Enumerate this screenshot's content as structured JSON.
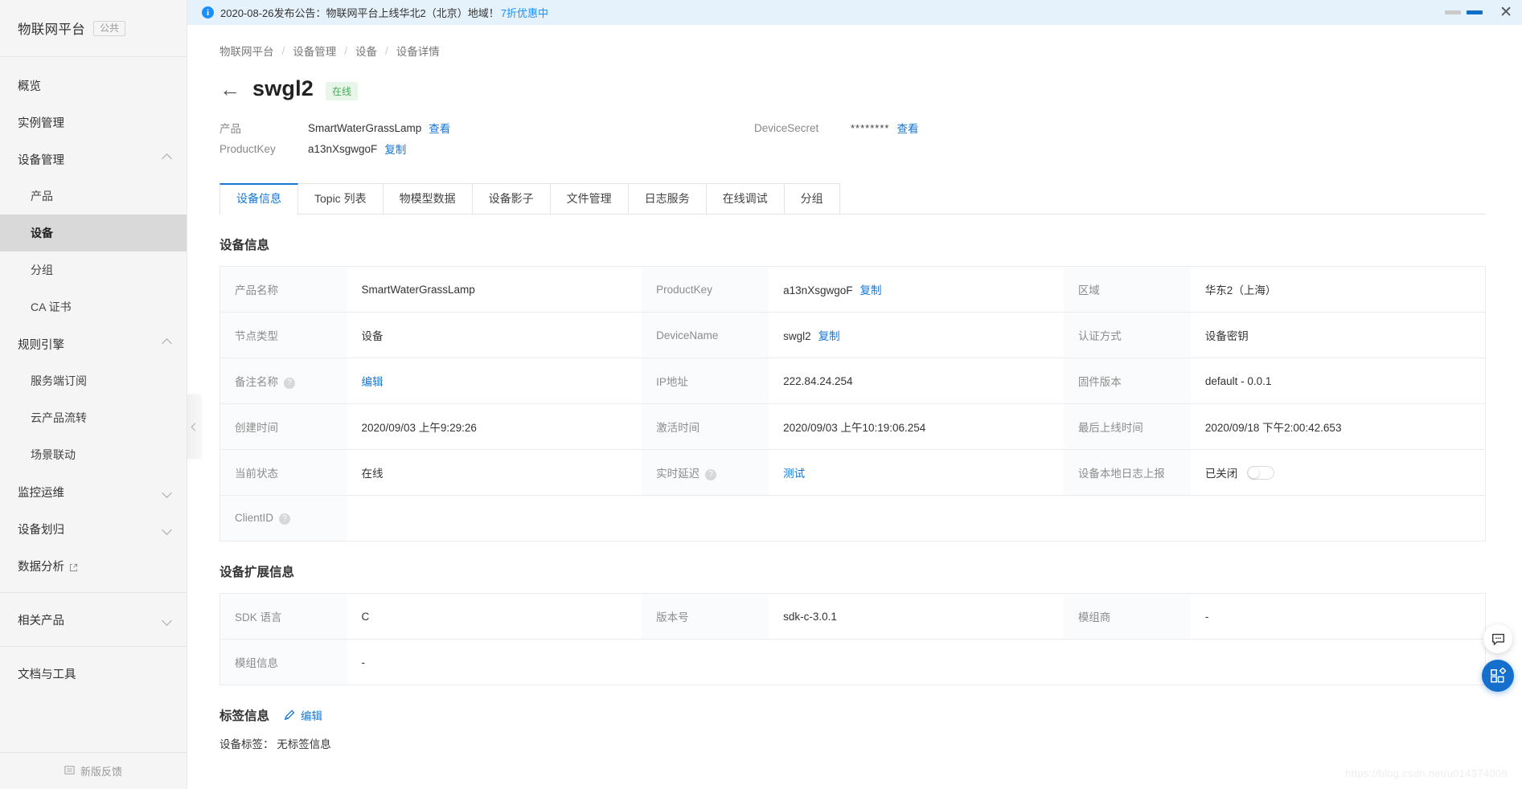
{
  "sidebar": {
    "brand": {
      "name": "物联网平台",
      "tag": "公共"
    },
    "items": [
      {
        "label": "概览",
        "level": "top",
        "caret": "none",
        "active": false
      },
      {
        "label": "实例管理",
        "level": "top",
        "caret": "none",
        "active": false
      },
      {
        "label": "设备管理",
        "level": "top",
        "caret": "up",
        "active": false
      },
      {
        "label": "产品",
        "level": "sub",
        "caret": "none",
        "active": false
      },
      {
        "label": "设备",
        "level": "sub",
        "caret": "none",
        "active": true
      },
      {
        "label": "分组",
        "level": "sub",
        "caret": "none",
        "active": false
      },
      {
        "label": "CA 证书",
        "level": "sub",
        "caret": "none",
        "active": false
      },
      {
        "label": "规则引擎",
        "level": "top",
        "caret": "up",
        "active": false
      },
      {
        "label": "服务端订阅",
        "level": "sub",
        "caret": "none",
        "active": false
      },
      {
        "label": "云产品流转",
        "level": "sub",
        "caret": "none",
        "active": false
      },
      {
        "label": "场景联动",
        "level": "sub",
        "caret": "none",
        "active": false
      },
      {
        "label": "监控运维",
        "level": "top",
        "caret": "down",
        "active": false
      },
      {
        "label": "设备划归",
        "level": "top",
        "caret": "down",
        "active": false
      },
      {
        "label": "数据分析",
        "level": "top",
        "caret": "none",
        "active": false,
        "external": true
      },
      {
        "label": "相关产品",
        "level": "top",
        "caret": "down",
        "active": false,
        "divider_before": true,
        "divider_after": true
      },
      {
        "label": "文档与工具",
        "level": "top",
        "caret": "none",
        "active": false
      }
    ],
    "footer": {
      "label": "新版反馈",
      "icon": "feedback-icon"
    }
  },
  "notice": {
    "text": "2020-08-26发布公告：物联网平台上线华北2（北京）地域！",
    "link": "7折优惠中",
    "close_label": "✕"
  },
  "breadcrumb": [
    "物联网平台",
    "设备管理",
    "设备",
    "设备详情"
  ],
  "header": {
    "back_label": "←",
    "device_name": "swgl2",
    "status_badge": "在线",
    "meta_left": [
      {
        "key": "产品",
        "value": "SmartWaterGrassLamp",
        "action": "查看"
      },
      {
        "key": "ProductKey",
        "value": "a13nXsgwgoF",
        "action": "复制"
      }
    ],
    "meta_right": {
      "key": "DeviceSecret",
      "value": "********",
      "action": "查看"
    }
  },
  "tabs": [
    {
      "label": "设备信息",
      "active": true
    },
    {
      "label": "Topic 列表",
      "active": false
    },
    {
      "label": "物模型数据",
      "active": false
    },
    {
      "label": "设备影子",
      "active": false
    },
    {
      "label": "文件管理",
      "active": false
    },
    {
      "label": "日志服务",
      "active": false
    },
    {
      "label": "在线调试",
      "active": false
    },
    {
      "label": "分组",
      "active": false
    }
  ],
  "device_info": {
    "section_title": "设备信息",
    "rows": [
      [
        {
          "key": "产品名称",
          "value": "SmartWaterGrassLamp"
        },
        {
          "key": "ProductKey",
          "value": "a13nXsgwgoF",
          "action": "复制"
        },
        {
          "key": "区域",
          "value": "华东2（上海）"
        }
      ],
      [
        {
          "key": "节点类型",
          "value": "设备"
        },
        {
          "key": "DeviceName",
          "value": "swgl2",
          "action": "复制"
        },
        {
          "key": "认证方式",
          "value": "设备密钥"
        }
      ],
      [
        {
          "key": "备注名称",
          "help": true,
          "link": "编辑"
        },
        {
          "key": "IP地址",
          "value": "222.84.24.254"
        },
        {
          "key": "固件版本",
          "value": "default - 0.0.1"
        }
      ],
      [
        {
          "key": "创建时间",
          "value": "2020/09/03 上午9:29:26"
        },
        {
          "key": "激活时间",
          "value": "2020/09/03 上午10:19:06.254"
        },
        {
          "key": "最后上线时间",
          "value": "2020/09/18 下午2:00:42.653"
        }
      ],
      [
        {
          "key": "当前状态",
          "value": "在线"
        },
        {
          "key": "实时延迟",
          "help": true,
          "link": "测试"
        },
        {
          "key": "设备本地日志上报",
          "value": "已关闭",
          "toggle": false
        }
      ],
      [
        {
          "key": "ClientID",
          "help": true,
          "value": ""
        },
        {
          "key": "",
          "value": ""
        },
        {
          "key": "",
          "value": ""
        }
      ]
    ]
  },
  "extended_info": {
    "section_title": "设备扩展信息",
    "rows": [
      [
        {
          "key": "SDK 语言",
          "value": "C"
        },
        {
          "key": "版本号",
          "value": "sdk-c-3.0.1"
        },
        {
          "key": "模组商",
          "value": "-"
        }
      ],
      [
        {
          "key": "模组信息",
          "value": "-"
        },
        {
          "key": "",
          "value": ""
        },
        {
          "key": "",
          "value": ""
        }
      ]
    ]
  },
  "tag_info": {
    "section_title": "标签信息",
    "edit_label": "编辑",
    "tag_key": "设备标签：",
    "tag_value": "无标签信息"
  },
  "floating": {
    "chat_icon": "chat-bubble-icon",
    "apps_icon": "apps-grid-icon"
  },
  "watermark": "https://blog.csdn.net/u014374009",
  "colors": {
    "accent": "#1677d2",
    "online_badge_bg": "#e8f6ea",
    "online_badge_fg": "#4aa85a",
    "notice_bg": "#e5f1fb",
    "sidebar_bg": "#f5f5f5",
    "sidebar_active": "#d9d9d9"
  }
}
